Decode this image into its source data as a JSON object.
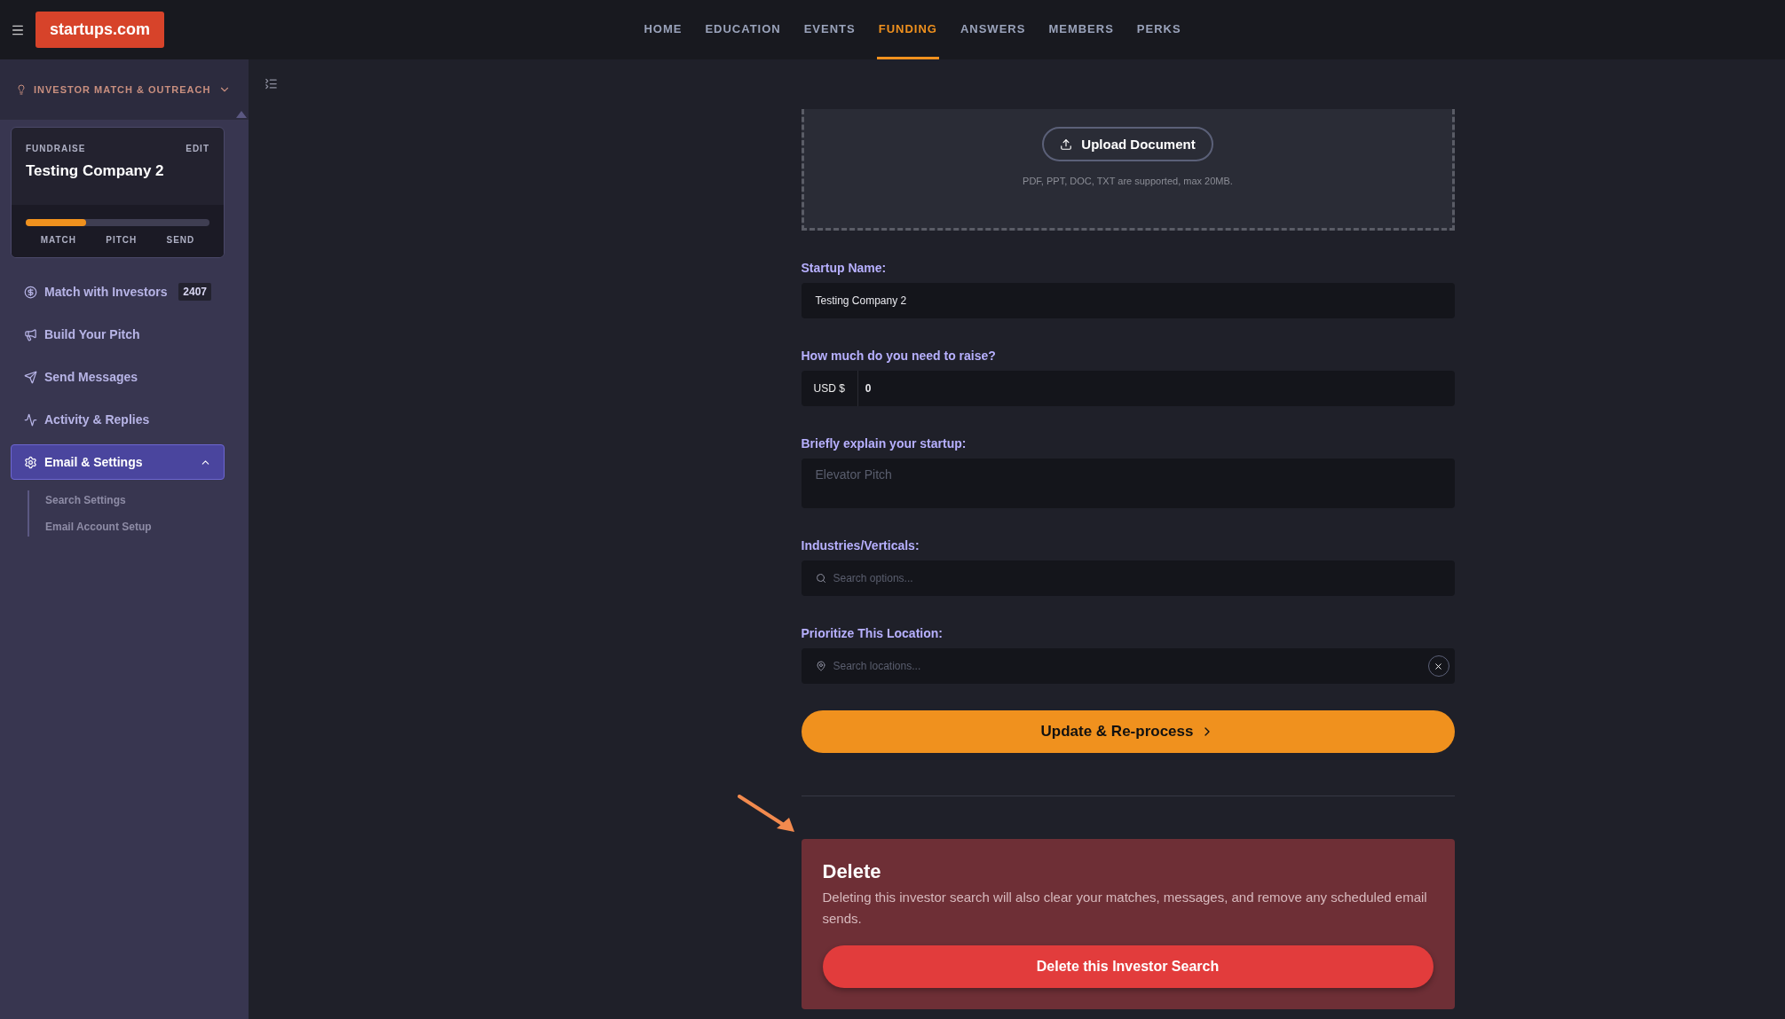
{
  "topbar": {
    "brand": "startups.com",
    "nav": [
      {
        "label": "HOME",
        "selected": false
      },
      {
        "label": "EDUCATION",
        "selected": false
      },
      {
        "label": "EVENTS",
        "selected": false
      },
      {
        "label": "FUNDING",
        "selected": true
      },
      {
        "label": "ANSWERS",
        "selected": false
      },
      {
        "label": "MEMBERS",
        "selected": false
      },
      {
        "label": "PERKS",
        "selected": false
      }
    ]
  },
  "sidebar": {
    "section": {
      "title": "INVESTOR MATCH & OUTREACH",
      "expanded": false
    },
    "card": {
      "label": "FUNDRAISE",
      "edit": "EDIT",
      "title": "Testing Company 2",
      "progress": {
        "level": 0.33
      },
      "steps": [
        "MATCH",
        "PITCH",
        "SEND"
      ]
    },
    "items": [
      {
        "kind": "dollar",
        "label": "Match with Investors",
        "badge": "2407",
        "selected": false
      },
      {
        "kind": "megaphone",
        "label": "Build Your Pitch",
        "selected": false
      },
      {
        "kind": "send",
        "label": "Send Messages",
        "selected": false
      },
      {
        "kind": "activity",
        "label": "Activity & Replies",
        "selected": false
      },
      {
        "kind": "gear",
        "label": "Email & Settings",
        "selected": true,
        "expanded": true,
        "children": [
          {
            "label": "Search Settings"
          },
          {
            "label": "Email Account Setup"
          }
        ]
      }
    ]
  },
  "form": {
    "upload": {
      "button": "Upload Document",
      "hint": "PDF, PPT, DOC, TXT are supported, max 20MB."
    },
    "fields": [
      {
        "kind": "text",
        "label": "Startup Name:",
        "value": "Testing Company 2"
      },
      {
        "kind": "currency",
        "label": "How much do you need to raise?",
        "prefix": "USD $",
        "value": "0"
      },
      {
        "kind": "textarea",
        "label": "Briefly explain your startup:",
        "placeholder": "Elevator Pitch"
      },
      {
        "kind": "search",
        "label": "Industries/Verticals:",
        "placeholder": "Search options..."
      },
      {
        "kind": "location",
        "label": "Prioritize This Location:",
        "placeholder": "Search locations..."
      }
    ],
    "submit": "Update & Re-process",
    "delete": {
      "title": "Delete",
      "text": "Deleting this investor search will also clear your matches, messages, and remove any scheduled email sends.",
      "button": "Delete this Investor Search"
    }
  }
}
